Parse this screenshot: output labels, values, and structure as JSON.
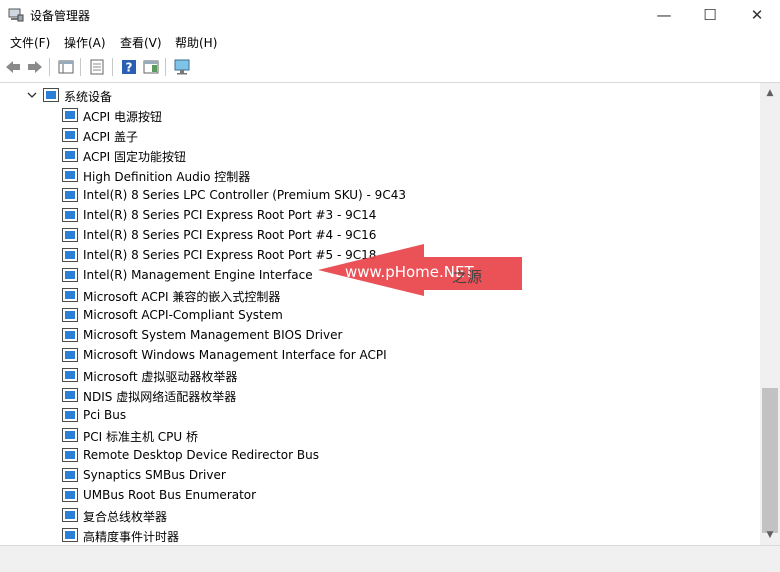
{
  "window": {
    "title": "设备管理器",
    "minimize": "—",
    "maximize": "☐",
    "close": "✕"
  },
  "menu": [
    "文件(F)",
    "操作(A)",
    "查看(V)",
    "帮助(H)"
  ],
  "toolbar": {
    "icons": [
      "back-icon",
      "forward-icon",
      "show-hide-tree-icon",
      "properties-icon",
      "help-icon",
      "action-pane-icon",
      "monitor-icon"
    ]
  },
  "tree": {
    "category": "系统设备",
    "devices": [
      "ACPI 电源按钮",
      "ACPI 盖子",
      "ACPI 固定功能按钮",
      "High Definition Audio 控制器",
      "Intel(R) 8 Series LPC Controller (Premium SKU) - 9C43",
      "Intel(R) 8 Series PCI Express Root Port #3 - 9C14",
      "Intel(R) 8 Series PCI Express Root Port #4 - 9C16",
      "Intel(R) 8 Series PCI Express Root Port #5 - 9C18",
      "Intel(R) Management Engine Interface",
      "Microsoft ACPI 兼容的嵌入式控制器",
      "Microsoft ACPI-Compliant System",
      "Microsoft System Management BIOS Driver",
      "Microsoft Windows Management Interface for ACPI",
      "Microsoft 虚拟驱动器枚举器",
      "NDIS 虚拟网络适配器枚举器",
      "Pci Bus",
      "PCI 标准主机 CPU 桥",
      "Remote Desktop Device Redirector Bus",
      "Synaptics SMBus Driver",
      "UMBus Root Bus Enumerator",
      "复合总线枚举器",
      "高精度事件计时器"
    ]
  },
  "overlay": {
    "watermark": "www.pHome.NET",
    "watermark_suffix": "之源"
  },
  "colors": {
    "arrow": "#e8434a",
    "icon_blue": "#2a7fd6"
  }
}
